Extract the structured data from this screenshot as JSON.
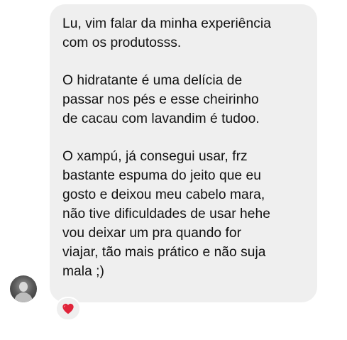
{
  "message": {
    "paragraphs": [
      "Lu, vim falar da minha experiência\ncom os produtosss.",
      "O hidratante é uma delícia de\npassar nos pés e esse cheirinho\nde cacau com lavandim é tudoo.",
      "O xampú, já consegui usar, frz\nbastante espuma do jeito que eu\ngosto e deixou meu cabelo mara,\nnão tive dificuldades de usar hehe\nvou deixar um pra quando for\nviajar, tão mais prático e não suja\nmala ;)"
    ],
    "reaction_icon": "red-heart-icon",
    "colors": {
      "bubble": "#efefef",
      "text": "#111111",
      "heart": "#e0243a"
    }
  }
}
